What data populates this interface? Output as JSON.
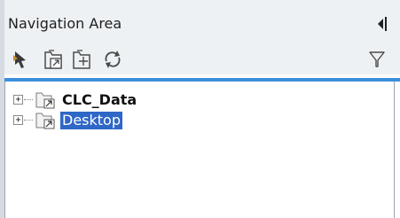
{
  "panel": {
    "title": "Navigation Area"
  },
  "toolbar": {
    "buttons": [
      {
        "icon": "pointer-arrow-icon"
      },
      {
        "icon": "folder-link-icon"
      },
      {
        "icon": "folder-add-icon"
      },
      {
        "icon": "refresh-icon"
      }
    ],
    "filter_icon": "filter-icon",
    "collapse_icon": "collapse-panel-icon"
  },
  "tree": {
    "items": [
      {
        "label": "CLC_Data",
        "expander": "+",
        "bold": true,
        "selected": false
      },
      {
        "label": "Desktop",
        "expander": "+",
        "bold": false,
        "selected": true
      }
    ]
  },
  "colors": {
    "accent": "#3c8fdc",
    "selection": "#2f67c7",
    "header_bg": "#eef1f4"
  }
}
